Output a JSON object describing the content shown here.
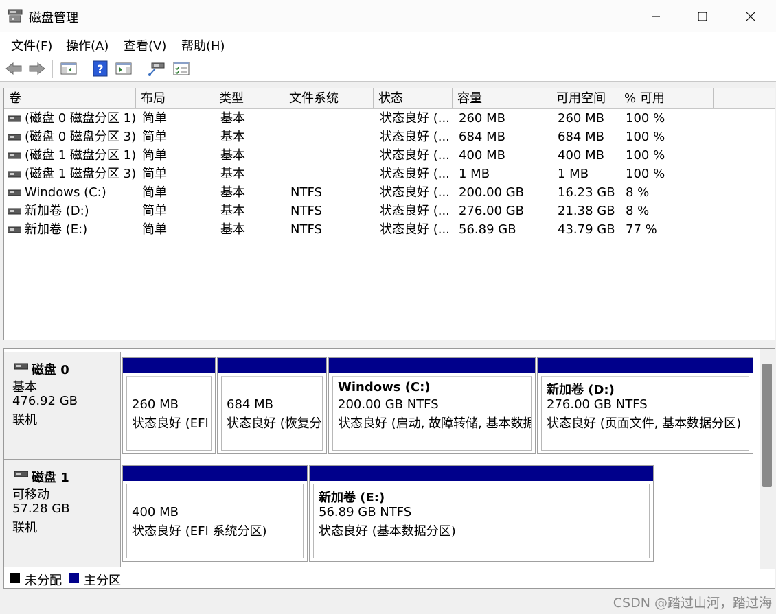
{
  "window": {
    "title": "磁盘管理",
    "icon": "disk-management-icon",
    "controls": [
      "minimize-icon",
      "maximize-icon",
      "close-icon"
    ]
  },
  "menu": [
    "文件(F)",
    "操作(A)",
    "查看(V)",
    "帮助(H)"
  ],
  "toolbar": [
    "back-arrow-icon",
    "forward-arrow-icon",
    "console-tree-icon",
    "help-icon",
    "show-action-pane-icon",
    "connect-disk-icon",
    "properties-checklist-icon"
  ],
  "columns": [
    "卷",
    "布局",
    "类型",
    "文件系统",
    "状态",
    "容量",
    "可用空间",
    "% 可用"
  ],
  "volumes": [
    {
      "name": "(磁盘 0 磁盘分区 1)",
      "layout": "简单",
      "type": "基本",
      "fs": "",
      "status": "状态良好 (...",
      "capacity": "260 MB",
      "free": "260 MB",
      "pct": "100 %"
    },
    {
      "name": "(磁盘 0 磁盘分区 3)",
      "layout": "简单",
      "type": "基本",
      "fs": "",
      "status": "状态良好 (...",
      "capacity": "684 MB",
      "free": "684 MB",
      "pct": "100 %"
    },
    {
      "name": "(磁盘 1 磁盘分区 1)",
      "layout": "简单",
      "type": "基本",
      "fs": "",
      "status": "状态良好 (...",
      "capacity": "400 MB",
      "free": "400 MB",
      "pct": "100 %"
    },
    {
      "name": "(磁盘 1 磁盘分区 3)",
      "layout": "简单",
      "type": "基本",
      "fs": "",
      "status": "状态良好 (...",
      "capacity": "1 MB",
      "free": "1 MB",
      "pct": "100 %"
    },
    {
      "name": "Windows (C:)",
      "layout": "简单",
      "type": "基本",
      "fs": "NTFS",
      "status": "状态良好 (...",
      "capacity": "200.00 GB",
      "free": "16.23 GB",
      "pct": "8 %"
    },
    {
      "name": "新加卷 (D:)",
      "layout": "简单",
      "type": "基本",
      "fs": "NTFS",
      "status": "状态良好 (...",
      "capacity": "276.00 GB",
      "free": "21.38 GB",
      "pct": "8 %"
    },
    {
      "name": "新加卷 (E:)",
      "layout": "简单",
      "type": "基本",
      "fs": "NTFS",
      "status": "状态良好 (...",
      "capacity": "56.89 GB",
      "free": "43.79 GB",
      "pct": "77 %"
    }
  ],
  "disks": [
    {
      "name": "磁盘 0",
      "kind": "基本",
      "size": "476.92 GB",
      "state": "联机",
      "partitions": [
        {
          "name": "",
          "line1": "260 MB",
          "line2": "状态良好 (EFI 系统分区)"
        },
        {
          "name": "",
          "line1": "684 MB",
          "line2": "状态良好 (恢复分区)"
        },
        {
          "name": "Windows  (C:)",
          "line1": "200.00 GB NTFS",
          "line2": "状态良好 (启动, 故障转储, 基本数据分区)"
        },
        {
          "name": "新加卷  (D:)",
          "line1": "276.00 GB NTFS",
          "line2": "状态良好 (页面文件, 基本数据分区)"
        }
      ]
    },
    {
      "name": "磁盘 1",
      "kind": "可移动",
      "size": "57.28 GB",
      "state": "联机",
      "partitions": [
        {
          "name": "",
          "line1": "400 MB",
          "line2": "状态良好 (EFI 系统分区)"
        },
        {
          "name": "新加卷  (E:)",
          "line1": "56.89 GB NTFS",
          "line2": "状态良好 (基本数据分区)"
        }
      ]
    }
  ],
  "legend": [
    {
      "label": "未分配",
      "color": "#000000"
    },
    {
      "label": "主分区",
      "color": "#00008b"
    }
  ],
  "watermark": "CSDN @踏过山河，踏过海",
  "colors": {
    "primary_partition": "#00008b",
    "unallocated": "#000000"
  }
}
